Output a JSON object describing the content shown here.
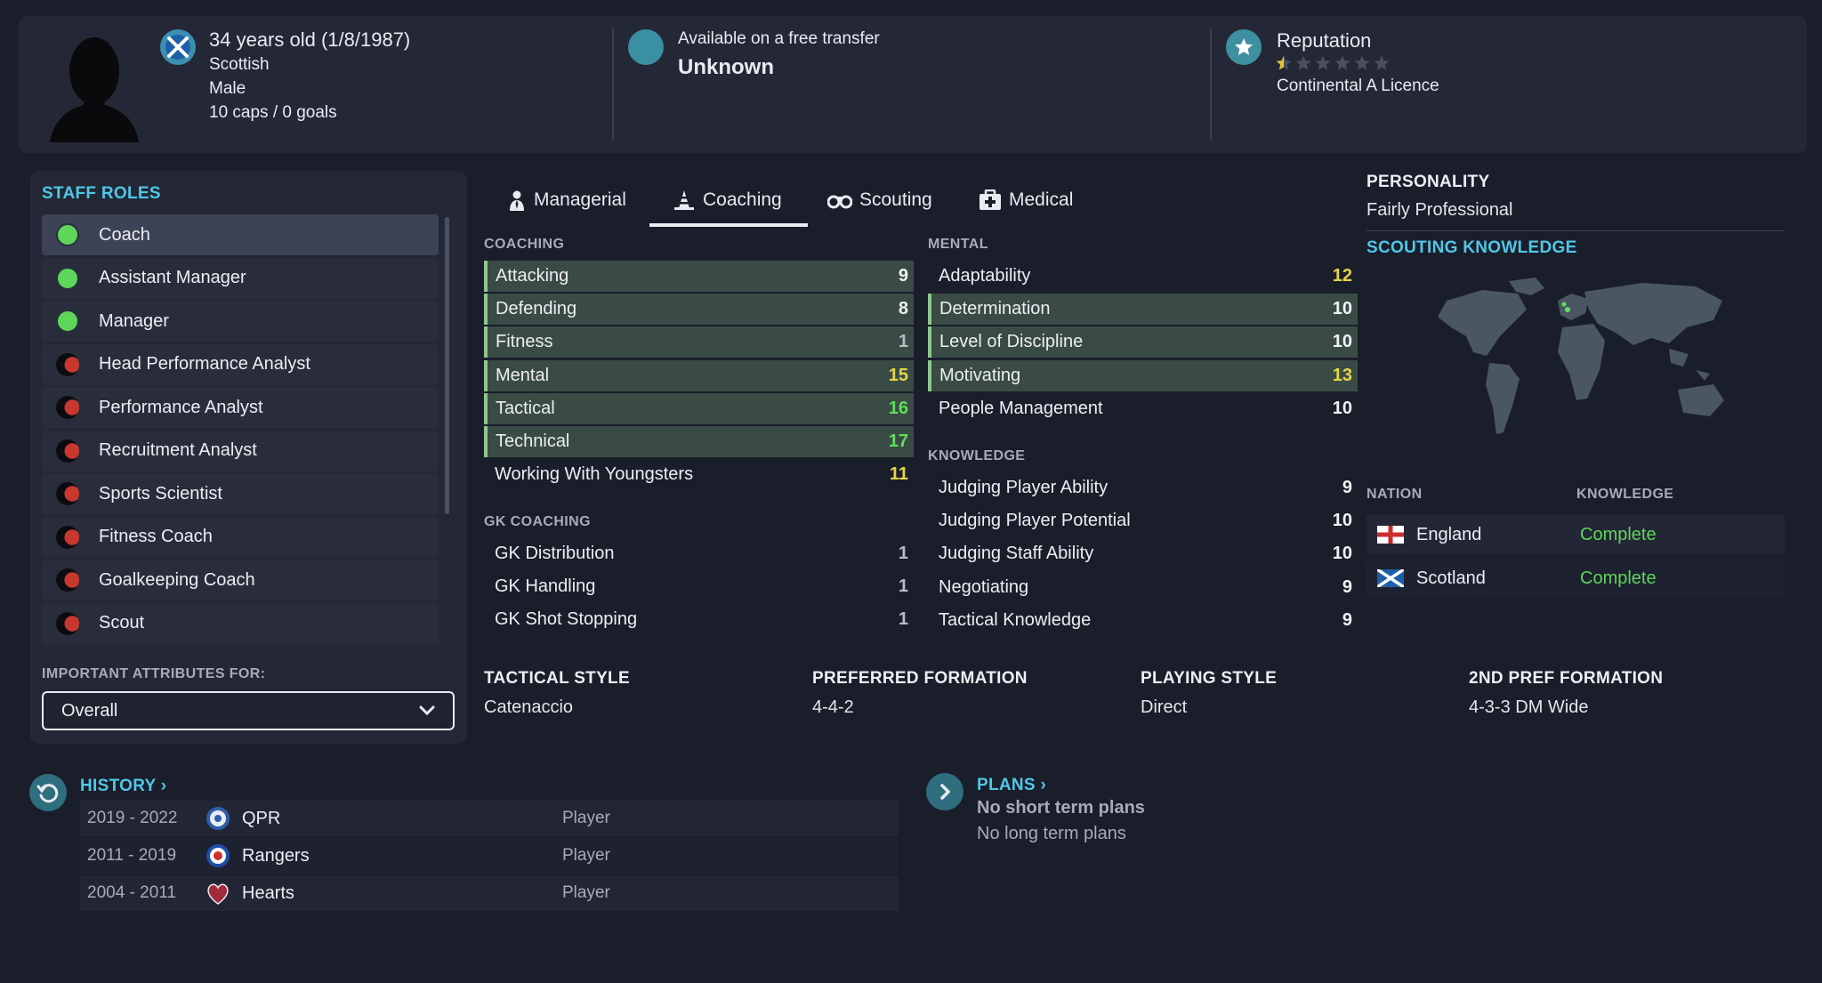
{
  "profile": {
    "age": "34 years old (1/8/1987)",
    "nationality": "Scottish",
    "gender": "Male",
    "caps": "10 caps / 0 goals",
    "transfer_status": "Available on a free transfer",
    "transfer_value": "Unknown",
    "reputation_label": "Reputation",
    "reputation_stars": 0.5,
    "reputation_max": 6,
    "licence": "Continental A Licence"
  },
  "staff_roles": {
    "title": "STAFF ROLES",
    "items": [
      {
        "label": "Coach",
        "status": "green",
        "selected": true
      },
      {
        "label": "Assistant Manager",
        "status": "green"
      },
      {
        "label": "Manager",
        "status": "green"
      },
      {
        "label": "Head Performance Analyst",
        "status": "red"
      },
      {
        "label": "Performance Analyst",
        "status": "red"
      },
      {
        "label": "Recruitment Analyst",
        "status": "red"
      },
      {
        "label": "Sports Scientist",
        "status": "red"
      },
      {
        "label": "Fitness Coach",
        "status": "red"
      },
      {
        "label": "Goalkeeping Coach",
        "status": "red"
      },
      {
        "label": "Scout",
        "status": "red"
      }
    ],
    "important_label": "IMPORTANT ATTRIBUTES FOR:",
    "important_value": "Overall"
  },
  "tabs": [
    {
      "label": "Managerial",
      "icon": "manager-icon"
    },
    {
      "label": "Coaching",
      "icon": "coach-icon",
      "active": true
    },
    {
      "label": "Scouting",
      "icon": "binoculars-icon"
    },
    {
      "label": "Medical",
      "icon": "medical-kit-icon"
    }
  ],
  "coaching": {
    "title": "COACHING",
    "rows": [
      {
        "label": "Attacking",
        "value": "9",
        "highlight": true,
        "color": "white"
      },
      {
        "label": "Defending",
        "value": "8",
        "highlight": true,
        "color": "white"
      },
      {
        "label": "Fitness",
        "value": "1",
        "highlight": true,
        "color": "grey"
      },
      {
        "label": "Mental",
        "value": "15",
        "highlight": true,
        "color": "yellow"
      },
      {
        "label": "Tactical",
        "value": "16",
        "highlight": true,
        "color": "green"
      },
      {
        "label": "Technical",
        "value": "17",
        "highlight": true,
        "color": "green"
      },
      {
        "label": "Working With Youngsters",
        "value": "11",
        "highlight": false,
        "color": "yellow"
      }
    ]
  },
  "gk_coaching": {
    "title": "GK COACHING",
    "rows": [
      {
        "label": "GK Distribution",
        "value": "1",
        "color": "grey"
      },
      {
        "label": "GK Handling",
        "value": "1",
        "color": "grey"
      },
      {
        "label": "GK Shot Stopping",
        "value": "1",
        "color": "grey"
      }
    ]
  },
  "mental": {
    "title": "MENTAL",
    "rows": [
      {
        "label": "Adaptability",
        "value": "12",
        "highlight": false,
        "color": "yellow"
      },
      {
        "label": "Determination",
        "value": "10",
        "highlight": true,
        "color": "white"
      },
      {
        "label": "Level of Discipline",
        "value": "10",
        "highlight": true,
        "color": "white"
      },
      {
        "label": "Motivating",
        "value": "13",
        "highlight": true,
        "color": "yellow"
      },
      {
        "label": "People Management",
        "value": "10",
        "highlight": false,
        "color": "white"
      }
    ]
  },
  "knowledge": {
    "title": "KNOWLEDGE",
    "rows": [
      {
        "label": "Judging Player Ability",
        "value": "9",
        "color": "white"
      },
      {
        "label": "Judging Player Potential",
        "value": "10",
        "color": "white"
      },
      {
        "label": "Judging Staff Ability",
        "value": "10",
        "color": "white"
      },
      {
        "label": "Negotiating",
        "value": "9",
        "color": "white"
      },
      {
        "label": "Tactical Knowledge",
        "value": "9",
        "color": "white"
      }
    ]
  },
  "styles": [
    {
      "heading": "TACTICAL STYLE",
      "value": "Catenaccio"
    },
    {
      "heading": "PREFERRED FORMATION",
      "value": "4-4-2"
    },
    {
      "heading": "PLAYING STYLE",
      "value": "Direct"
    },
    {
      "heading": "2ND PREF FORMATION",
      "value": "4-3-3 DM Wide"
    }
  ],
  "personality": {
    "title": "PERSONALITY",
    "value": "Fairly Professional"
  },
  "scouting_knowledge": {
    "title": "SCOUTING KNOWLEDGE",
    "col_nation": "NATION",
    "col_knowledge": "KNOWLEDGE",
    "nations": [
      {
        "name": "England",
        "knowledge": "Complete",
        "flag": "england-flag"
      },
      {
        "name": "Scotland",
        "knowledge": "Complete",
        "flag": "scotland-flag"
      }
    ]
  },
  "history": {
    "title": "HISTORY",
    "rows": [
      {
        "years": "2019 - 2022",
        "club": "QPR",
        "role": "Player"
      },
      {
        "years": "2011 - 2019",
        "club": "Rangers",
        "role": "Player"
      },
      {
        "years": "2004 - 2011",
        "club": "Hearts",
        "role": "Player"
      }
    ]
  },
  "plans": {
    "title": "PLANS",
    "short_term": "No short term plans",
    "long_term": "No long term plans"
  },
  "colors": {
    "background": "#1a1e2b",
    "panel": "#242836",
    "accent_cyan": "#4fc8e6",
    "good_green": "#5ee05a",
    "ok_yellow": "#e5d546",
    "highlight_row": "#3a4b45"
  }
}
